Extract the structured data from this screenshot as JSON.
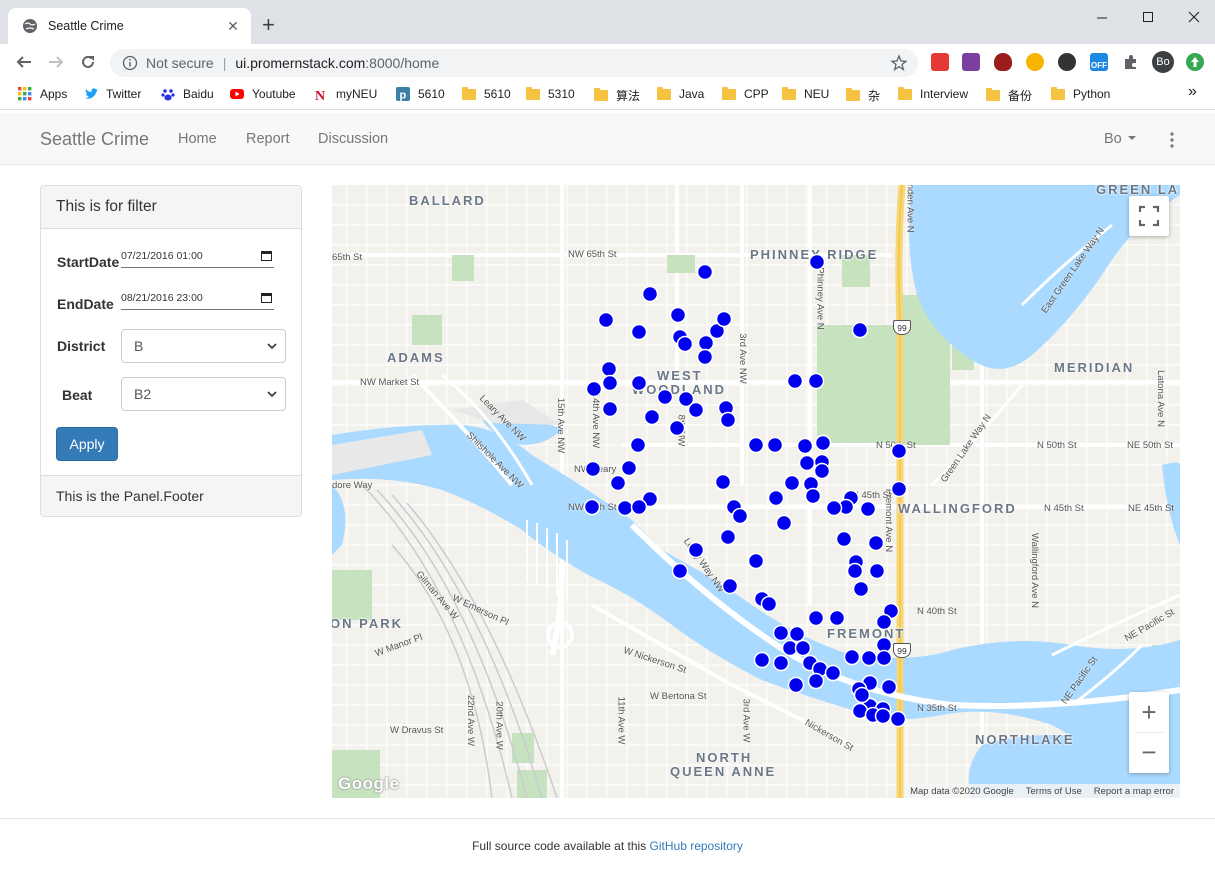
{
  "browser": {
    "tab_title": "Seattle Crime",
    "new_tab": "+",
    "address": {
      "not_secure": "Not secure",
      "host": "ui.promernstack.com",
      "path": ":8000/home"
    },
    "bookmarks": [
      {
        "label": "Apps",
        "icon": "apps-grid-icon"
      },
      {
        "label": "Twitter",
        "icon": "twitter-icon"
      },
      {
        "label": "Baidu",
        "icon": "baidu-icon"
      },
      {
        "label": "Youtube",
        "icon": "youtube-icon"
      },
      {
        "label": "myNEU",
        "icon": "neu-icon"
      },
      {
        "label": "5610",
        "icon": "p-icon"
      },
      {
        "label": "5610",
        "icon": "folder-icon"
      },
      {
        "label": "5310",
        "icon": "folder-icon"
      },
      {
        "label": "算法",
        "icon": "folder-icon"
      },
      {
        "label": "Java",
        "icon": "folder-icon"
      },
      {
        "label": "CPP",
        "icon": "folder-icon"
      },
      {
        "label": "NEU",
        "icon": "folder-icon"
      },
      {
        "label": "杂",
        "icon": "folder-icon"
      },
      {
        "label": "Interview",
        "icon": "folder-icon"
      },
      {
        "label": "备份",
        "icon": "folder-icon"
      },
      {
        "label": "Python",
        "icon": "folder-icon"
      }
    ],
    "overflow": "»",
    "profile_initials": "Bo",
    "ext_badge": "OFF"
  },
  "app": {
    "brand": "Seattle Crime",
    "nav": [
      "Home",
      "Report",
      "Discussion"
    ],
    "user": "Bo"
  },
  "filter": {
    "heading": "This is for filter",
    "start_label": "StartDate",
    "start_value": "07/21/2016 01:00",
    "end_label": "EndDate",
    "end_value": "08/21/2016 23:00",
    "district_label": "District",
    "district_value": "B",
    "beat_label": "Beat",
    "beat_value": "B2",
    "apply": "Apply",
    "footer": "This is the Panel.Footer"
  },
  "map": {
    "neighborhoods": [
      "BALLARD",
      "PHINNEY RIDGE",
      "GREEN LA",
      "ADAMS",
      "WEST",
      "WOODLAND",
      "MERIDIAN",
      "WALLINGFORD",
      "FREMONT",
      "ON PARK",
      "NORTH",
      "QUEEN ANNE",
      "NORTHLAKE"
    ],
    "streets": [
      "NW 65th St",
      "65th St",
      "NW Market St",
      "N 50th St",
      "N 50th St",
      "NE 50th St",
      "N 45th St",
      "N 45th St",
      "N 40th St",
      "NE Pacific St",
      "N 35th St",
      "W Nickerson St",
      "W Bertona St",
      "W Dravus St",
      "W Emerson Pl",
      "W Manor Pl",
      "Gilman Ave W",
      "Shilshole Ave NW",
      "Leary Ave NW",
      "15th Ave NW",
      "14th Ave NW",
      "8th NW",
      "3rd Ave NW",
      "Phinney Ave N",
      "East Green Lake Way N",
      "Green Lake Way N",
      "Latona Ave N",
      "Wallingford Ave N",
      "NE Pacific St",
      "Leary Way NW",
      "Nickerson St",
      "22nd Ave W",
      "20th Ave W",
      "11th Ave W",
      "3rd Ave W",
      "NW Leary",
      "NW 46th St",
      "Fremont Ave N",
      "dore Way",
      "Linden Ave N",
      "NE 45th St"
    ],
    "highway_shield": "99",
    "attribution": [
      "Map data ©2020 Google",
      "Terms of Use",
      "Report a map error"
    ],
    "google_logo": "Google",
    "marker_color": "#0000ee",
    "zoom_in": "+",
    "zoom_out": "−"
  },
  "footer": {
    "text": "Full source code available at this ",
    "link": "GitHub repository"
  }
}
